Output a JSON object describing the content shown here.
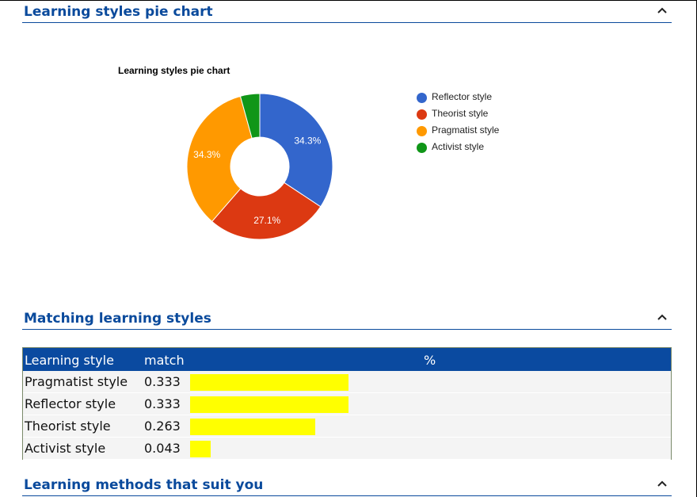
{
  "sections": {
    "pie": {
      "title": "Learning styles pie chart"
    },
    "matching": {
      "title": "Matching learning styles"
    },
    "methods": {
      "title": "Learning methods that suit you"
    }
  },
  "chart_data": {
    "type": "pie",
    "title": "Learning styles pie chart",
    "donut": true,
    "categories": [
      "Reflector style",
      "Theorist style",
      "Pragmatist style",
      "Activist style"
    ],
    "values": [
      34.3,
      27.1,
      34.3,
      4.3
    ],
    "labels": [
      "34.3%",
      "27.1%",
      "34.3%",
      ""
    ],
    "colors": [
      "#3366cc",
      "#dc3912",
      "#ff9900",
      "#109618"
    ],
    "legend_position": "right"
  },
  "table": {
    "headers": {
      "style": "Learning style",
      "match": "match",
      "percent": "%"
    },
    "bar_color": "#ffff00",
    "rows": [
      {
        "style": "Pragmatist style",
        "match": "0.333",
        "fraction": 0.333
      },
      {
        "style": "Reflector style",
        "match": "0.333",
        "fraction": 0.333
      },
      {
        "style": "Theorist style",
        "match": "0.263",
        "fraction": 0.263
      },
      {
        "style": "Activist style",
        "match": "0.043",
        "fraction": 0.043
      }
    ]
  }
}
